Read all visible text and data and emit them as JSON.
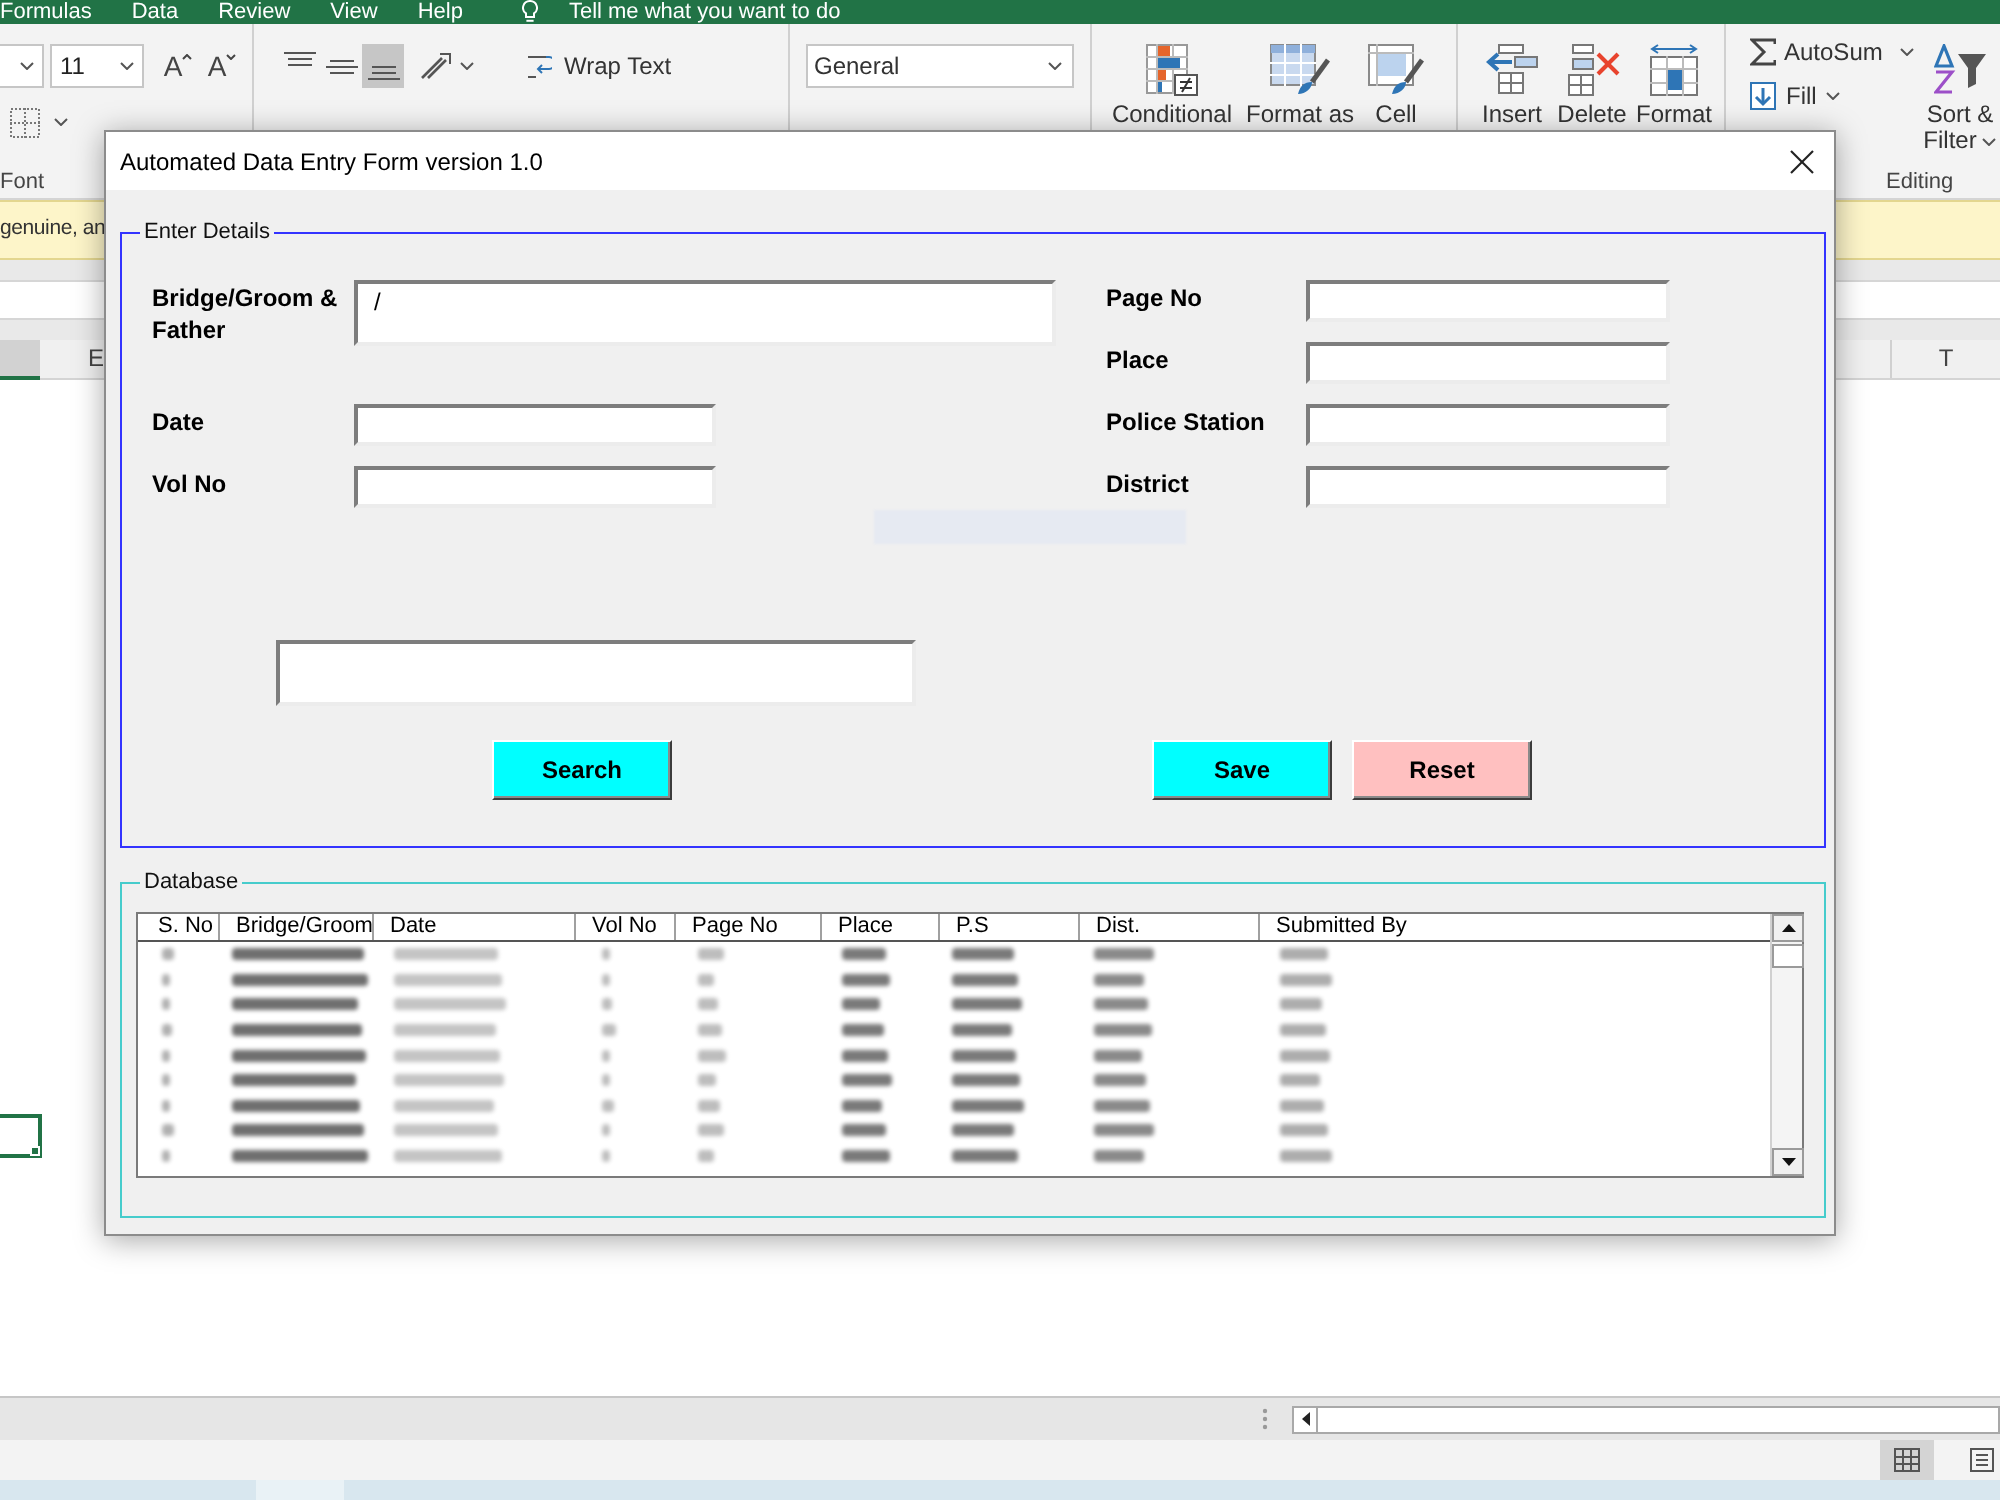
{
  "excel": {
    "menu_tabs": [
      "Formulas",
      "Data",
      "Review",
      "View",
      "Help"
    ],
    "tell_me": "Tell me what you want to do",
    "ribbon": {
      "font_size": "11",
      "font_size_buttons": [
        {
          "kind": "grow",
          "glyph": "A"
        },
        {
          "kind": "shrink",
          "glyph": "A"
        }
      ],
      "font_group_label": "Font",
      "alignment_buttons": [
        {
          "kind": "top",
          "selected": false
        },
        {
          "kind": "middle",
          "selected": false
        },
        {
          "kind": "bottom",
          "selected": true
        }
      ],
      "wrap_text": "Wrap Text",
      "number_format": "General",
      "style_buttons": [
        {
          "kind": "conditional",
          "label": "Conditional"
        },
        {
          "kind": "table",
          "label": "Format as"
        },
        {
          "kind": "cell",
          "label": "Cell"
        }
      ],
      "cell_buttons": [
        {
          "kind": "insert",
          "label": "Insert"
        },
        {
          "kind": "delete",
          "label": "Delete"
        },
        {
          "kind": "format",
          "label": "Format"
        }
      ],
      "autosum": "AutoSum",
      "fill": "Fill",
      "sort_filter": [
        "Sort &",
        "Filter"
      ],
      "editing_group_label": "Editing"
    },
    "message_bar": "genuine, an",
    "column_headers": [
      "E",
      "T"
    ],
    "view_buttons": [
      {
        "kind": "normal",
        "selected": true
      },
      {
        "kind": "page_layout",
        "selected": false
      }
    ]
  },
  "dialog": {
    "title": "Automated Data Entry Form version 1.0",
    "details": {
      "legend": "Enter Details",
      "left_fields": [
        {
          "kind": "multiline",
          "label": "Bridge/Groom & Father",
          "value": "/"
        },
        {
          "kind": "single",
          "label": "Date"
        },
        {
          "kind": "single",
          "label": "Vol No"
        }
      ],
      "right_fields": [
        {
          "label": "Page No"
        },
        {
          "label": "Place"
        },
        {
          "label": "Police Station"
        },
        {
          "label": "District"
        }
      ],
      "buttons": [
        {
          "label": "Search",
          "color": "#00ffff"
        },
        {
          "label": "Save",
          "color": "#00ffff"
        },
        {
          "label": "Reset",
          "color": "#ffc0c0"
        }
      ]
    },
    "database": {
      "legend": "Database",
      "columns": [
        "S. No",
        "Bridge/Groom",
        "Date",
        "Vol No",
        "Page No",
        "Place",
        "P.S",
        "Dist.",
        "Submitted By"
      ]
    }
  }
}
